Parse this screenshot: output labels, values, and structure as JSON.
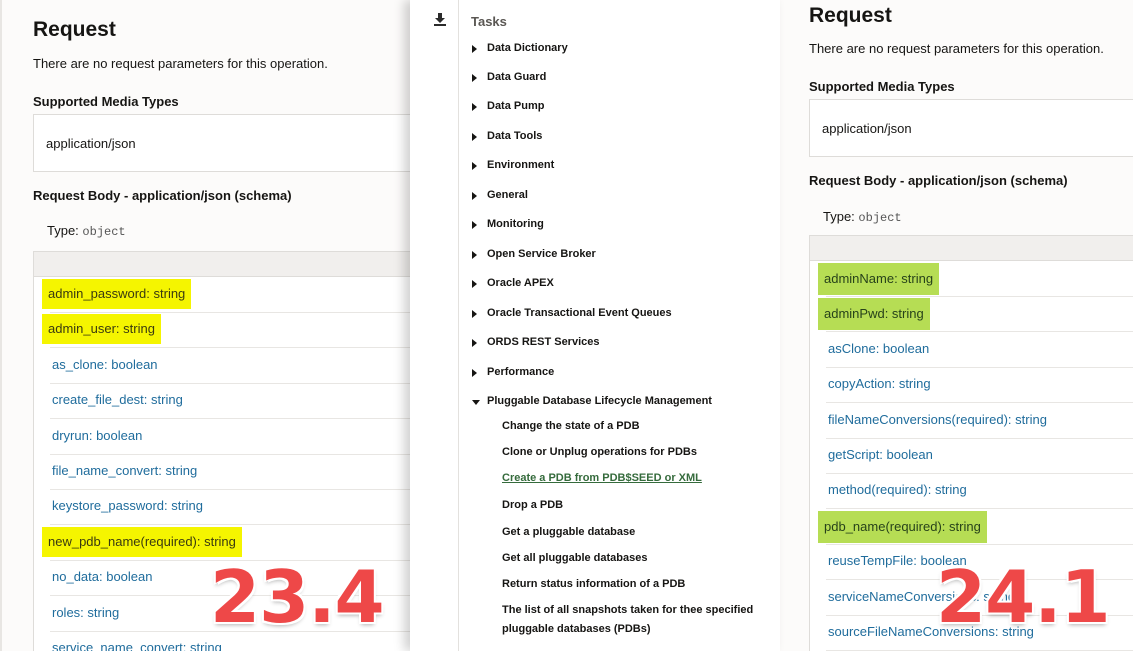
{
  "left": {
    "title": "Request",
    "no_params": "There are no request parameters for this operation.",
    "media_types_heading": "Supported Media Types",
    "media_type": "application/json",
    "body_heading": "Request Body - application/json (schema)",
    "type_label": "Type:",
    "type_value": "object",
    "fields": [
      {
        "text": "admin_password: string",
        "highlight": "yellow"
      },
      {
        "text": "admin_user: string",
        "highlight": "yellow"
      },
      {
        "text": "as_clone: boolean",
        "highlight": ""
      },
      {
        "text": "create_file_dest: string",
        "highlight": ""
      },
      {
        "text": "dryrun: boolean",
        "highlight": ""
      },
      {
        "text": "file_name_convert: string",
        "highlight": ""
      },
      {
        "text": "keystore_password: string",
        "highlight": ""
      },
      {
        "text": "new_pdb_name(required): string",
        "highlight": "yellow"
      },
      {
        "text": "no_data: boolean",
        "highlight": ""
      },
      {
        "text": "roles: string",
        "highlight": ""
      },
      {
        "text": "service_name_convert: string",
        "highlight": ""
      }
    ],
    "version": "23.4"
  },
  "nav": {
    "tasks_title": "Tasks",
    "download_icon": "download-icon",
    "items": [
      {
        "label": "Data Dictionary",
        "expanded": false
      },
      {
        "label": "Data Guard",
        "expanded": false
      },
      {
        "label": "Data Pump",
        "expanded": false
      },
      {
        "label": "Data Tools",
        "expanded": false
      },
      {
        "label": "Environment",
        "expanded": false
      },
      {
        "label": "General",
        "expanded": false
      },
      {
        "label": "Monitoring",
        "expanded": false
      },
      {
        "label": "Open Service Broker",
        "expanded": false
      },
      {
        "label": "Oracle APEX",
        "expanded": false
      },
      {
        "label": "Oracle Transactional Event Queues",
        "expanded": false
      },
      {
        "label": "ORDS REST Services",
        "expanded": false
      },
      {
        "label": "Performance",
        "expanded": false
      },
      {
        "label": "Pluggable Database Lifecycle Management",
        "expanded": true
      }
    ],
    "subitems": [
      {
        "label": "Change the state of a PDB",
        "active": false
      },
      {
        "label": "Clone or Unplug operations for PDBs",
        "active": false
      },
      {
        "label": "Create a PDB from PDB$SEED or XML",
        "active": true
      },
      {
        "label": "Drop a PDB",
        "active": false
      },
      {
        "label": "Get a pluggable database",
        "active": false
      },
      {
        "label": "Get all pluggable databases",
        "active": false
      },
      {
        "label": "Return status information of a PDB",
        "active": false
      },
      {
        "label": "The list of all snapshots taken for thee specified pluggable databases (PDBs)",
        "active": false
      }
    ]
  },
  "right": {
    "title": "Request",
    "no_params": "There are no request parameters for this operation.",
    "media_types_heading": "Supported Media Types",
    "media_type": "application/json",
    "body_heading": "Request Body - application/json (schema)",
    "type_label": "Type:",
    "type_value": "object",
    "fields": [
      {
        "text": "adminName: string",
        "highlight": "green"
      },
      {
        "text": "adminPwd: string",
        "highlight": "green"
      },
      {
        "text": "asClone: boolean",
        "highlight": ""
      },
      {
        "text": "copyAction: string",
        "highlight": ""
      },
      {
        "text": "fileNameConversions(required): string",
        "highlight": ""
      },
      {
        "text": "getScript: boolean",
        "highlight": ""
      },
      {
        "text": "method(required): string",
        "highlight": ""
      },
      {
        "text": "pdb_name(required): string",
        "highlight": "green"
      },
      {
        "text": "reuseTempFile: boolean",
        "highlight": ""
      },
      {
        "text": "serviceNameConversions: string",
        "highlight": ""
      },
      {
        "text": "sourceFileNameConversions: string",
        "highlight": ""
      }
    ],
    "version": "24.1"
  }
}
